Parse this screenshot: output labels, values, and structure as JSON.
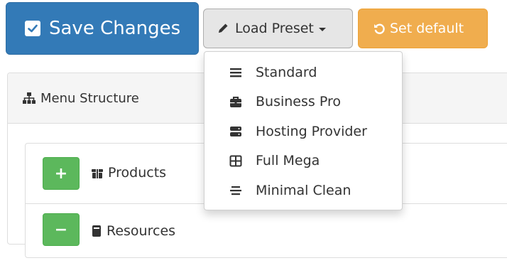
{
  "toolbar": {
    "save_label": "Save Changes",
    "load_preset_label": "Load Preset",
    "set_default_label": "Set default"
  },
  "preset_menu": {
    "items": [
      {
        "label": "Standard",
        "icon": "bars-icon"
      },
      {
        "label": "Business Pro",
        "icon": "briefcase-icon"
      },
      {
        "label": "Hosting Provider",
        "icon": "server-icon"
      },
      {
        "label": "Full Mega",
        "icon": "grid-icon"
      },
      {
        "label": "Minimal Clean",
        "icon": "align-icon"
      }
    ]
  },
  "panel": {
    "title": "Menu Structure",
    "items": [
      {
        "toggle": "+",
        "label": "Products",
        "icon": "box-icon"
      },
      {
        "toggle": "−",
        "label": "Resources",
        "icon": "book-icon"
      }
    ]
  },
  "colors": {
    "primary": "#337ab7",
    "warning": "#f0ad4e",
    "success": "#5cb85c",
    "default_btn": "#e6e6e6"
  }
}
